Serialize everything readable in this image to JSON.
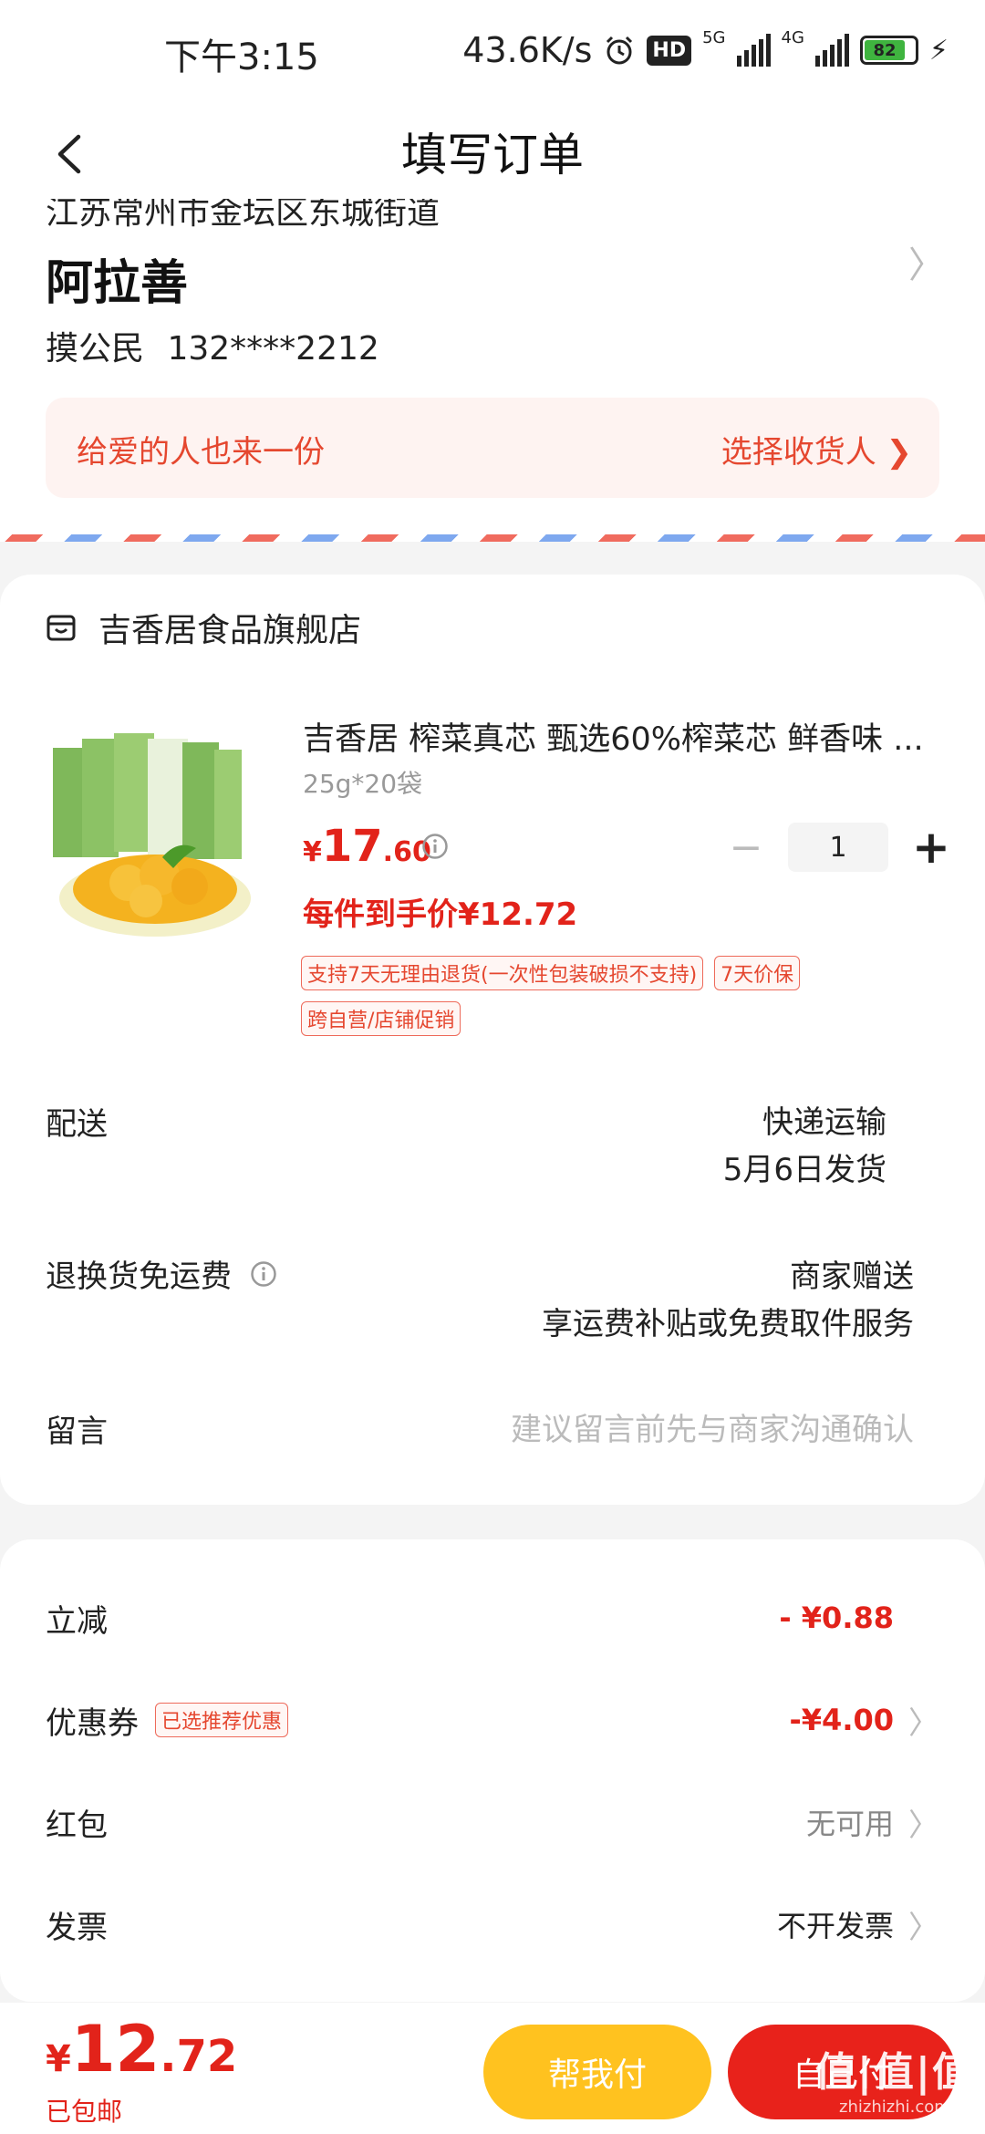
{
  "status_bar": {
    "time": "下午3:15",
    "speed": "43.6K/s",
    "hd": "HD",
    "net1": "5G",
    "net2": "4G",
    "battery": "82",
    "battery_fraction": 0.82,
    "icons": [
      "alarm-icon",
      "signal-icon",
      "battery-icon",
      "charging-icon"
    ]
  },
  "nav": {
    "title": "填写订单"
  },
  "address": {
    "line": "江苏常州市金坛区东城街道",
    "name": "阿拉善",
    "contact_name": "摸公民",
    "phone": "132****2212",
    "gift_text": "给爱的人也来一份",
    "gift_action": "选择收货人 ❯"
  },
  "store": {
    "name": "吉香居食品旗舰店",
    "product": {
      "title": "吉香居 榨菜真芯 甄选60%榨菜芯 鲜香味 ...",
      "spec": "25g*20袋",
      "price_symbol": "¥",
      "price_int": "17",
      "price_dec": ".60",
      "quantity": "1",
      "unit_price": "每件到手价¥12.72",
      "tags": [
        "支持7天无理由退货(一次性包装破损不支持)",
        "7天价保",
        "跨自营/店铺促销"
      ]
    },
    "delivery": {
      "label": "配送",
      "method": "快递运输",
      "ship_date": "5月6日发货"
    },
    "return_shipping": {
      "label": "退换货免运费",
      "value": "商家赠送",
      "detail": "享运费补贴或免费取件服务"
    },
    "message": {
      "label": "留言",
      "placeholder": "建议留言前先与商家沟通确认"
    }
  },
  "discounts": {
    "instant": {
      "label": "立减",
      "value": "- ¥0.88"
    },
    "coupon": {
      "label": "优惠券",
      "badge": "已选推荐优惠",
      "value": "-¥4.00"
    },
    "red_packet": {
      "label": "红包",
      "value": "无可用"
    },
    "invoice": {
      "label": "发票",
      "value": "不开发票"
    },
    "chevron": "〉"
  },
  "bottom": {
    "symbol": "¥",
    "total_int": "12",
    "total_dec": ".72",
    "shipping_note": "已包邮",
    "help_pay": "帮我付",
    "self_pay": "自己付"
  },
  "watermark": {
    "logo": "值|值|值",
    "text": "zhizhizhi.com"
  },
  "colors": {
    "accent_red": "#e2231a",
    "help_yellow": "#ffc21f",
    "banner_bg": "#fef3f1"
  }
}
